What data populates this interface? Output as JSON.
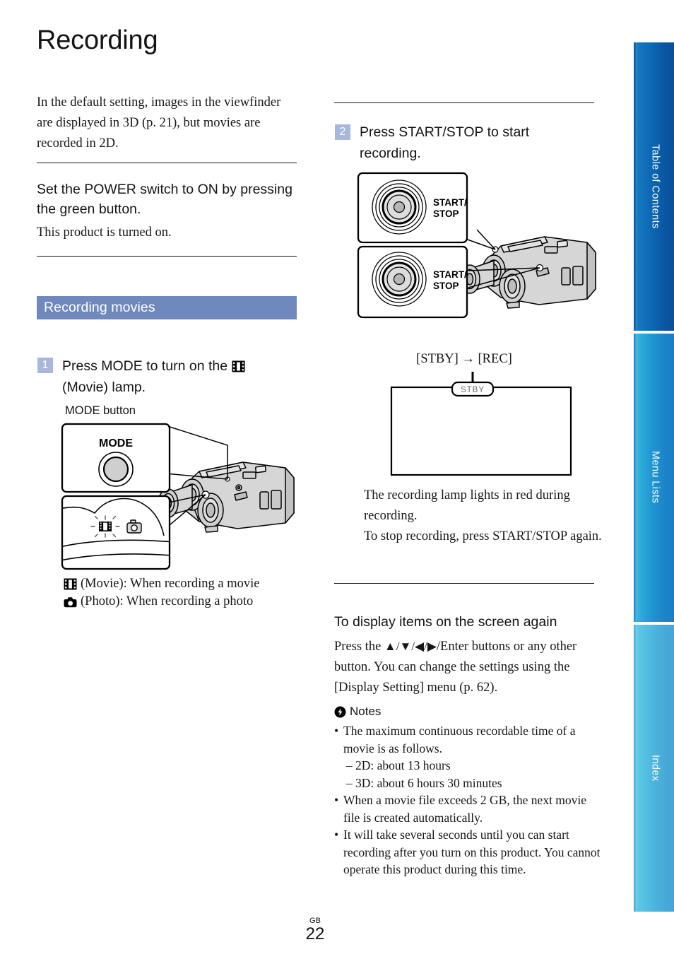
{
  "page": {
    "title": "Recording",
    "footer_region": "GB",
    "footer_number": "22"
  },
  "sidebar": {
    "tabs": [
      {
        "label": "Table of Contents",
        "color": "#0b62ae"
      },
      {
        "label": "Menu Lists",
        "color": "#1f93d0"
      },
      {
        "label": "Index",
        "color": "#4bb4dd"
      }
    ]
  },
  "left_column": {
    "intro": "In the default setting, images in the viewfinder are displayed in 3D (p. 21), but movies are recorded in 2D.",
    "power_heading": "Set the POWER switch to ON by pressing the green button.",
    "power_body": "This product is turned on.",
    "section_title": "Recording movies",
    "step1": {
      "number": "1",
      "text_before_icon": "Press MODE to turn on the ",
      "icon": "movie-film-icon",
      "text_after_icon": "(Movie) lamp."
    },
    "mode_button_caption": "MODE button",
    "mode_panel_label": "MODE",
    "legend": [
      {
        "icon": "movie-film-icon",
        "text": "(Movie): When recording a movie"
      },
      {
        "icon": "photo-camera-icon",
        "text": "(Photo): When recording a photo"
      }
    ]
  },
  "right_column": {
    "step2": {
      "number": "2",
      "text": "Press START/STOP to start recording."
    },
    "startstop_label_top": "START/\nSTOP",
    "startstop_label_bottom": "START/\nSTOP",
    "stby_rec_caption": "[STBY]  →  [REC]",
    "screen_badge": "STBY",
    "after_text": "The recording lamp lights in red during recording.\nTo stop recording, press START/STOP again.",
    "display_heading": "To display items on the screen again",
    "display_body_1": "Press the ",
    "display_arrows": "▲/▼/◀/▶",
    "display_body_2": "/Enter buttons or any other button. You can change the settings using the [Display Setting] menu (p. 62).",
    "notes_title": "Notes",
    "notes": [
      {
        "type": "bullet",
        "text": "The maximum continuous recordable time of a movie is as follows."
      },
      {
        "type": "dash",
        "text": "2D: about 13 hours"
      },
      {
        "type": "dash",
        "text": "3D: about 6 hours 30 minutes"
      },
      {
        "type": "bullet",
        "text": "When a movie file exceeds 2 GB, the next movie file is created automatically."
      },
      {
        "type": "bullet",
        "text": "It will take several seconds until you can start recording after you turn on this product. You cannot operate this product during this time."
      }
    ]
  },
  "colors": {
    "section_bar": "#7089bd",
    "step_badge": "#a8b8dd",
    "tab_1": "#0b62ae",
    "tab_2": "#1f93d0",
    "tab_3": "#4bb4dd"
  }
}
